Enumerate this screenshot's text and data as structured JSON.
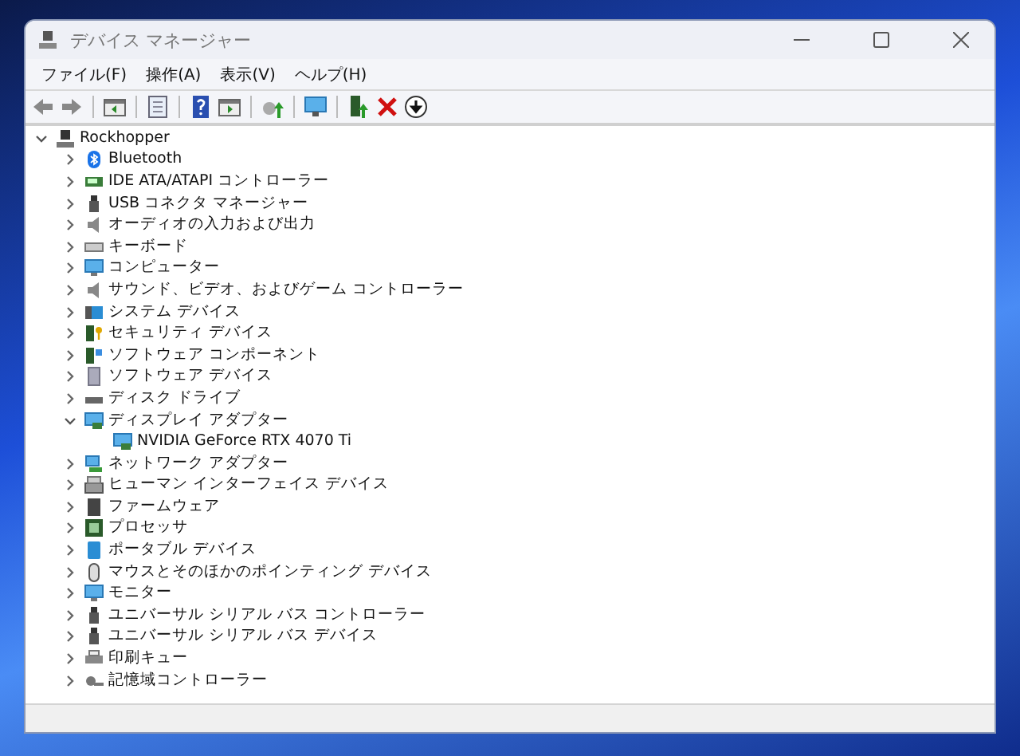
{
  "window": {
    "title": "デバイス マネージャー"
  },
  "menu": [
    {
      "label": "ファイル(F)"
    },
    {
      "label": "操作(A)"
    },
    {
      "label": "表示(V)"
    },
    {
      "label": "ヘルプ(H)"
    }
  ],
  "tree": {
    "label": "Rockhopper",
    "expanded": true,
    "children": [
      {
        "label": "Bluetooth",
        "expanded": false
      },
      {
        "label": "IDE ATA/ATAPI コントローラー",
        "expanded": false
      },
      {
        "label": "USB コネクタ マネージャー",
        "expanded": false
      },
      {
        "label": "オーディオの入力および出力",
        "expanded": false
      },
      {
        "label": "キーボード",
        "expanded": false
      },
      {
        "label": "コンピューター",
        "expanded": false
      },
      {
        "label": "サウンド、ビデオ、およびゲーム コントローラー",
        "expanded": false
      },
      {
        "label": "システム デバイス",
        "expanded": false
      },
      {
        "label": "セキュリティ デバイス",
        "expanded": false
      },
      {
        "label": "ソフトウェア コンポーネント",
        "expanded": false
      },
      {
        "label": "ソフトウェア デバイス",
        "expanded": false
      },
      {
        "label": "ディスク ドライブ",
        "expanded": false
      },
      {
        "label": "ディスプレイ アダプター",
        "expanded": true,
        "children": [
          {
            "label": "NVIDIA GeForce RTX 4070 Ti"
          }
        ]
      },
      {
        "label": "ネットワーク アダプター",
        "expanded": false
      },
      {
        "label": "ヒューマン インターフェイス デバイス",
        "expanded": false
      },
      {
        "label": "ファームウェア",
        "expanded": false
      },
      {
        "label": "プロセッサ",
        "expanded": false
      },
      {
        "label": "ポータブル デバイス",
        "expanded": false
      },
      {
        "label": "マウスとそのほかのポインティング デバイス",
        "expanded": false
      },
      {
        "label": "モニター",
        "expanded": false
      },
      {
        "label": "ユニバーサル シリアル バス コントローラー",
        "expanded": false
      },
      {
        "label": "ユニバーサル シリアル バス デバイス",
        "expanded": false
      },
      {
        "label": "印刷キュー",
        "expanded": false
      },
      {
        "label": "記憶域コントローラー",
        "expanded": false
      }
    ]
  }
}
